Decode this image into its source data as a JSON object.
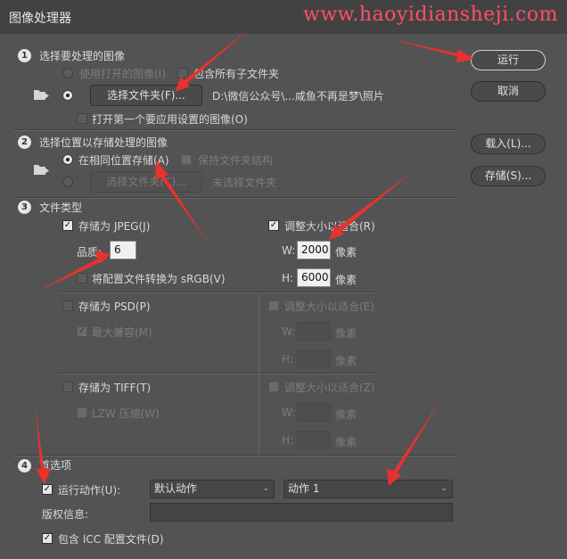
{
  "window": {
    "title": "图像处理器",
    "watermark": "www.haoyidiansheji.com"
  },
  "actions": {
    "run": "运行",
    "cancel": "取消",
    "load": "载入(L)...",
    "save": "存储(S)..."
  },
  "section1": {
    "number": "1",
    "title": "选择要处理的图像",
    "use_open": "使用打开的图像(I)",
    "include_subfolders": "包含所有子文件夹",
    "select_folder": "选择文件夹(F)...",
    "folder_path": "D:\\微信公众号\\...咸鱼不再是梦\\照片",
    "open_first": "打开第一个要应用设置的图像(O)"
  },
  "section2": {
    "number": "2",
    "title": "选择位置以存储处理的图像",
    "same_location": "在相同位置存储(A)",
    "keep_structure": "保持文件夹结构",
    "select_folder": "选择文件夹(C)...",
    "no_folder": "未选择文件夹"
  },
  "section3": {
    "number": "3",
    "title": "文件类型",
    "jpeg": {
      "save_as": "存储为 JPEG(J)",
      "quality_label": "品质:",
      "quality_value": "6",
      "convert": "将配置文件转换为 sRGB(V)",
      "resize": "调整大小以适合(R)",
      "w_label": "W:",
      "w_value": "2000",
      "h_label": "H:",
      "h_value": "6000",
      "unit": "像素"
    },
    "psd": {
      "save_as": "存储为 PSD(P)",
      "maximize": "最大兼容(M)",
      "resize": "调整大小以适合(E)",
      "w_label": "W:",
      "h_label": "H:",
      "unit": "像素"
    },
    "tiff": {
      "save_as": "存储为 TIFF(T)",
      "lzw": "LZW 压缩(W)",
      "resize": "调整大小以适合(Z)",
      "w_label": "W:",
      "h_label": "H:",
      "unit": "像素"
    }
  },
  "section4": {
    "number": "4",
    "title": "首选项",
    "run_action": "运行动作(U):",
    "action_set": "默认动作",
    "action": "动作 1",
    "copyright": "版权信息:",
    "copyright_value": "",
    "include_icc": "包含 ICC 配置文件(D)"
  },
  "colors": {
    "background": "#535353",
    "titlebar": "#424242",
    "watermark": "#ff4f6a",
    "arrow": "#e8322e"
  },
  "icons": {
    "folder_open": "folder-arrow-icon",
    "folder_save": "folder-arrow-icon"
  }
}
